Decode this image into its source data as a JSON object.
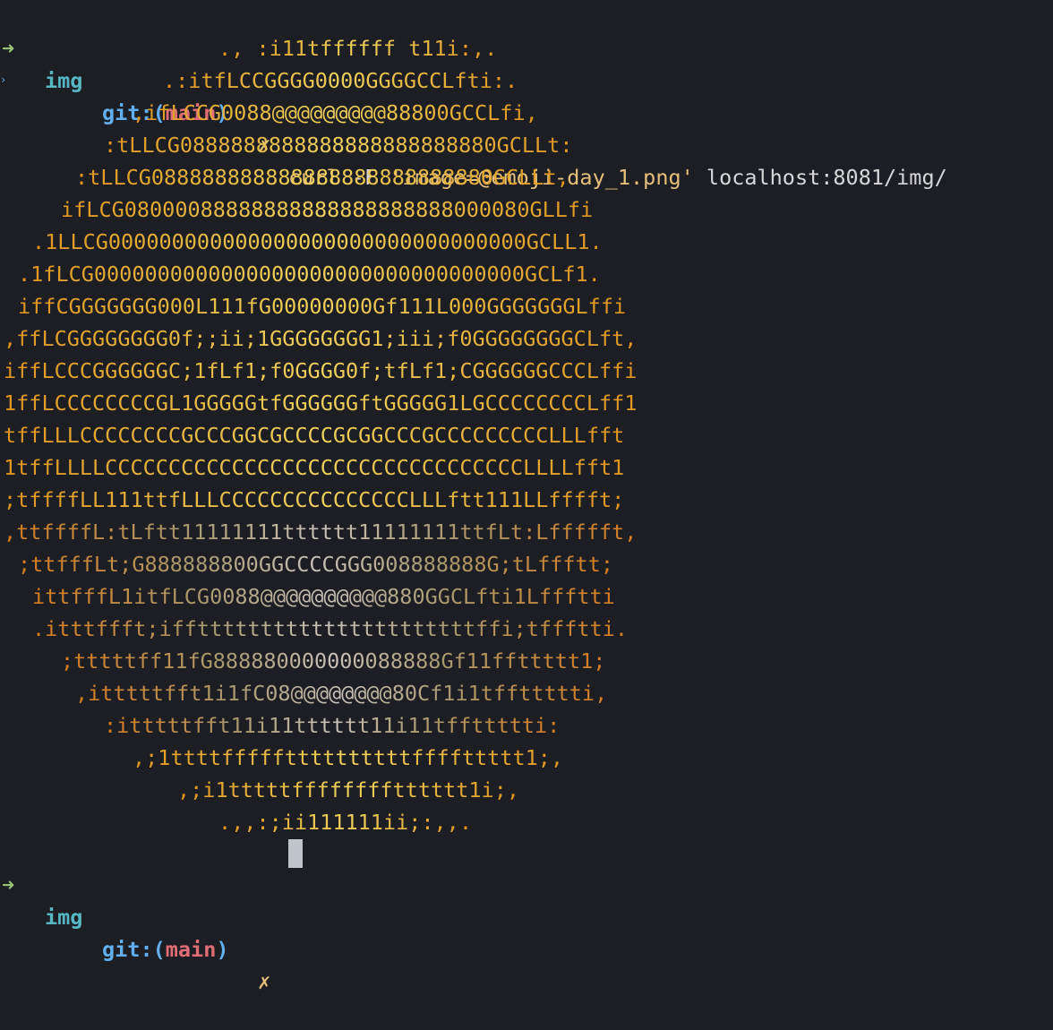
{
  "prompt1": {
    "arrow": "➜",
    "dir": "img",
    "git_prefix": "git:(",
    "branch": "main",
    "git_suffix": ")",
    "dirty": "✗",
    "command": "curl",
    "flag": "-F",
    "arg_string": "'image=@emoji-day_1.png'",
    "url": "localhost:8081/img/"
  },
  "ascii_art": [
    "., :i11tffffff t11i:,.",
    ".:itfLCCGGGG0000GGGGCCLfti:.",
    ",ifLCCG0088@@@@@@@@@88800GCCLfi,",
    ":tLLCG0888888888888888888888880GCLLt:",
    ":tLLCG088888888888888888888888880GCLLt,",
    "ifLCG08000088888888888888888888000080GLLfi",
    ".1LLCG000000000000000000000000000000000GCLL1.",
    ".1fLCG0000000000000000000000000000000000GCLf1.",
    "iffCGGGGGGG000L111fG00000000Gf111L000GGGGGGGLffi",
    ",ffLCGGGGGGGG0f;;ii;1GGGGGGGG1;iii;f0GGGGGGGGCLft,",
    "iffLCCCGGGGGGC;1fLf1;f0GGGG0f;tfLf1;CGGGGGGCCCLffi",
    "1ffLCCCCCCCCGL1GGGGGtfGGGGGGftGGGGG1LGCCCCCCCCLff1",
    "tffLLLCCCCCCCCGCCCGGCGCCCCGCGGCCCGCCCCCCCCCLLLfft",
    "1tffLLLLCCCCCCCCCCCCCCCCCCCCCCCCCCCCCCCCCLLLLfft1",
    ";tffffLL111ttfLLLCCCCCCCCCCCCCCCLLLftt111LLfffft;",
    ",ttffffL:tLftt11111111tttttt11111111ttfLt:Lffffft,",
    ";ttfffLt;G888888800GGCCCCGGG008888888G;tLffftt;",
    "ittfffL1itfLCG0088@@@@@@@@@@880GGCLfti1Lffftti",
    ".itttffft;iffttttttttttttttttttttttffi;tffftti.",
    ";tttttff11fG888880000000088888Gf11ffttttt1;",
    ",itttttfft1i1fC08@@@@@@@@80Cf1i1tffttttti,",
    ":itttttfft11i11tttttt11i11tffttttti:",
    ",;1ttttfffffttttttttttffffttttt1;,",
    ",;i1tttttfffffffftttttt1i;,",
    ".,,:;ii111111ii;:,,."
  ],
  "prompt2": {
    "arrow": "➜",
    "dir": "img",
    "git_prefix": "git:(",
    "branch": "main",
    "git_suffix": ")",
    "dirty": "✗"
  }
}
